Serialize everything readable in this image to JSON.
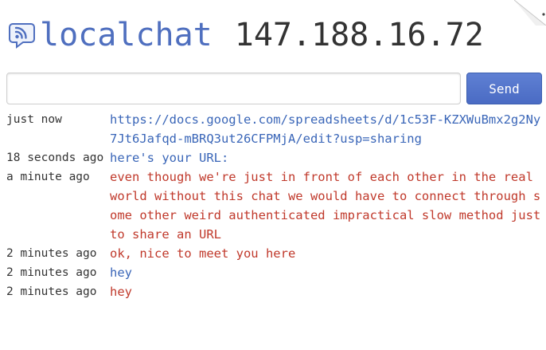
{
  "header": {
    "app_name": "localchat",
    "host": "147.188.16.72",
    "logo_icon": "chat-rss-icon"
  },
  "composer": {
    "input_value": "",
    "send_label": "Send"
  },
  "colors": {
    "self_message": "#3a66b8",
    "other_message": "#c0392b",
    "accent": "#4f6fbf"
  },
  "messages": [
    {
      "time": "just now",
      "text": "https://docs.google.com/spreadsheets/d/1c53F-KZXWuBmx2g2Ny7Jt6Jafqd-mBRQ3ut26CFPMjA/edit?usp=sharing",
      "sender": "self",
      "is_link": true
    },
    {
      "time": "18 seconds ago",
      "text": "here's your URL:",
      "sender": "self",
      "is_link": false
    },
    {
      "time": "a minute ago",
      "text": "even though we're just in front of each other in the real world without this chat we would have to connect through some other weird authenticated impractical slow method just to share an URL",
      "sender": "other",
      "is_link": false
    },
    {
      "time": "2 minutes ago",
      "text": "ok, nice to meet you here",
      "sender": "other",
      "is_link": false
    },
    {
      "time": "2 minutes ago",
      "text": "hey",
      "sender": "self",
      "is_link": false
    },
    {
      "time": "2 minutes ago",
      "text": "hey",
      "sender": "other",
      "is_link": false
    }
  ]
}
